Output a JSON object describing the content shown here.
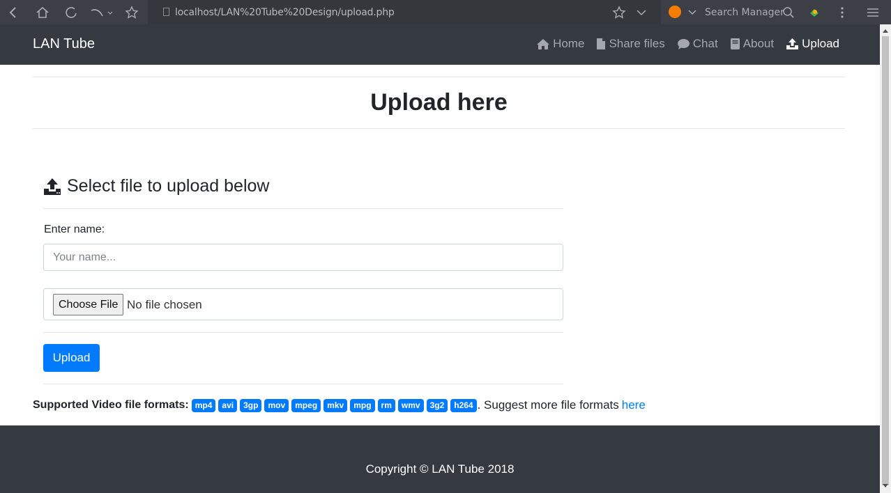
{
  "browser": {
    "url": "localhost/LAN%20Tube%20Design/upload.php",
    "search_placeholder": "Search Manager"
  },
  "navbar": {
    "brand": "LAN Tube",
    "items": [
      {
        "label": "Home",
        "icon": "home-icon"
      },
      {
        "label": "Share files",
        "icon": "file-icon"
      },
      {
        "label": "Chat",
        "icon": "chat-icon"
      },
      {
        "label": "About",
        "icon": "book-icon"
      },
      {
        "label": "Upload",
        "icon": "upload-icon",
        "active": true
      }
    ]
  },
  "main": {
    "title": "Upload here",
    "section_heading": "Select file to upload below",
    "name_label": "Enter name:",
    "name_placeholder": "Your name...",
    "choose_file_label": "Choose File",
    "no_file_text": "No file chosen",
    "upload_button": "Upload",
    "formats_label": "Supported Video file formats:",
    "formats": [
      "mp4",
      "avi",
      "3gp",
      "mov",
      "mpeg",
      "mkv",
      "mpg",
      "rm",
      "wmv",
      "3g2",
      "h264"
    ],
    "suggest_text": ". Suggest more file formats",
    "suggest_link": "here"
  },
  "footer": {
    "copyright": "Copyright © LAN Tube 2018"
  },
  "colors": {
    "primary": "#007bff",
    "dark": "#343a40"
  }
}
